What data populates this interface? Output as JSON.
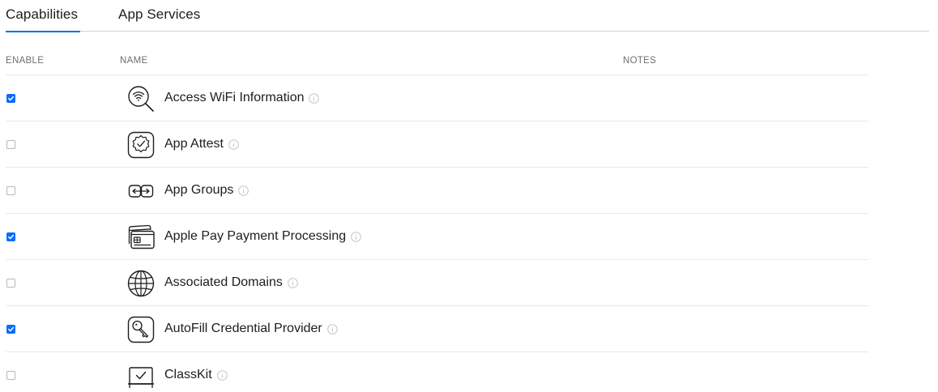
{
  "tabs": [
    {
      "label": "Capabilities",
      "active": true
    },
    {
      "label": "App Services",
      "active": false
    }
  ],
  "columns": {
    "enable": "ENABLE",
    "name": "NAME",
    "notes": "NOTES"
  },
  "capabilities": [
    {
      "name": "Access WiFi Information",
      "enabled": true,
      "icon": "wifi-search-icon"
    },
    {
      "name": "App Attest",
      "enabled": false,
      "icon": "app-attest-badge-icon"
    },
    {
      "name": "App Groups",
      "enabled": false,
      "icon": "app-groups-icon"
    },
    {
      "name": "Apple Pay Payment Processing",
      "enabled": true,
      "icon": "apple-pay-cards-icon"
    },
    {
      "name": "Associated Domains",
      "enabled": false,
      "icon": "globe-icon"
    },
    {
      "name": "AutoFill Credential Provider",
      "enabled": true,
      "icon": "key-icon"
    },
    {
      "name": "ClassKit",
      "enabled": false,
      "icon": "classkit-icon"
    }
  ],
  "colors": {
    "accent": "#0071e3",
    "checkbox_checked": "#0a6cff",
    "divider": "#e8e8ed"
  }
}
